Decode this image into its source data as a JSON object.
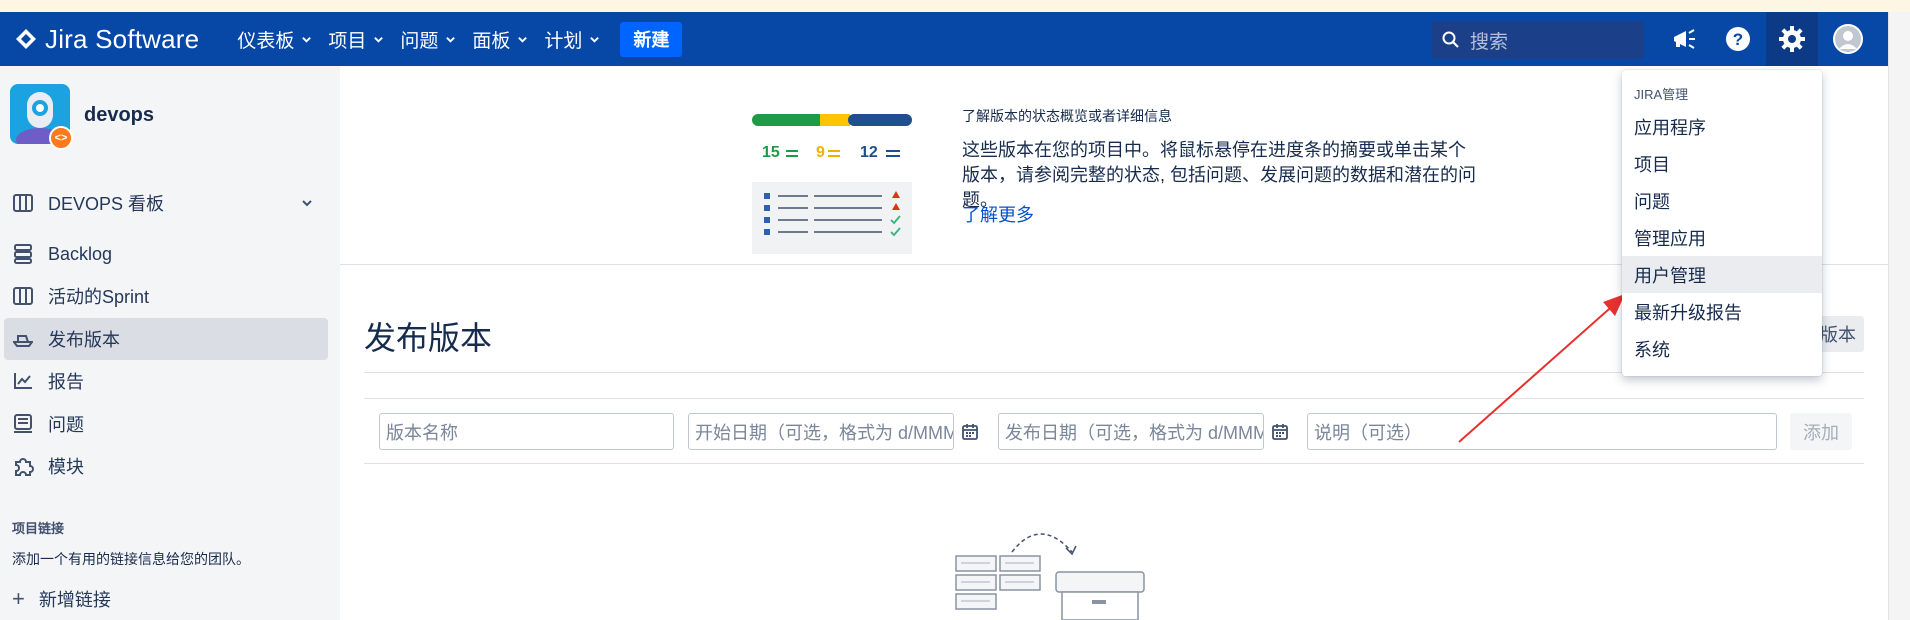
{
  "nav": {
    "logo_text": "Jira Software",
    "menu": [
      {
        "label": "仪表板"
      },
      {
        "label": "项目"
      },
      {
        "label": "问题"
      },
      {
        "label": "面板"
      },
      {
        "label": "计划"
      }
    ],
    "create_label": "新建",
    "search_placeholder": "搜索",
    "icons": [
      "notifications-icon",
      "help-icon",
      "settings-icon",
      "user-avatar"
    ]
  },
  "sidebar": {
    "project_name": "devops",
    "items": [
      {
        "label": "DEVOPS 看板",
        "icon": "board-icon"
      },
      {
        "label": "Backlog",
        "icon": "backlog-icon"
      },
      {
        "label": "活动的Sprint",
        "icon": "sprint-icon"
      },
      {
        "label": "发布版本",
        "icon": "ship-icon",
        "selected": true
      },
      {
        "label": "报告",
        "icon": "chart-icon"
      },
      {
        "label": "问题",
        "icon": "issues-icon"
      },
      {
        "label": "模块",
        "icon": "component-icon"
      }
    ],
    "links_title": "项目链接",
    "links_desc": "添加一个有用的链接信息给您的团队。",
    "add_link_label": "新增链接"
  },
  "info": {
    "counts": [
      "15",
      "9",
      "12"
    ],
    "title": "了解版本的状态概览或者详细信息",
    "text": "这些版本在您的项目中。将鼠标悬停在进度条的摘要或单击某个版本，请参阅完整的状态, 包括问题、发展问题的数据和潜在的问题。",
    "link": "了解更多"
  },
  "main": {
    "title": "发布版本",
    "version_button_fragment": "版本",
    "form": {
      "name_placeholder": "版本名称",
      "start_placeholder": "开始日期（可选，格式为 d/MMM/yy）",
      "release_placeholder": "发布日期（可选，格式为 d/MMM/yy）",
      "desc_placeholder": "说明（可选）",
      "add_label": "添加"
    }
  },
  "dropdown": {
    "heading": "JIRA管理",
    "items": [
      {
        "label": "应用程序"
      },
      {
        "label": "项目"
      },
      {
        "label": "问题"
      },
      {
        "label": "管理应用"
      },
      {
        "label": "用户管理",
        "hover": true
      },
      {
        "label": "最新升级报告"
      },
      {
        "label": "系统"
      }
    ]
  },
  "colors": {
    "nav_bg": "#0747a6",
    "create_bg": "#0065ff",
    "sidebar_bg": "#f4f5f7",
    "selected_bg": "#dadde4",
    "link": "#0052cc",
    "progress_done": "#36b37e",
    "progress_inprogress": "#ffc400",
    "progress_todo": "#0052cc",
    "annotation_arrow": "#e8312f"
  }
}
